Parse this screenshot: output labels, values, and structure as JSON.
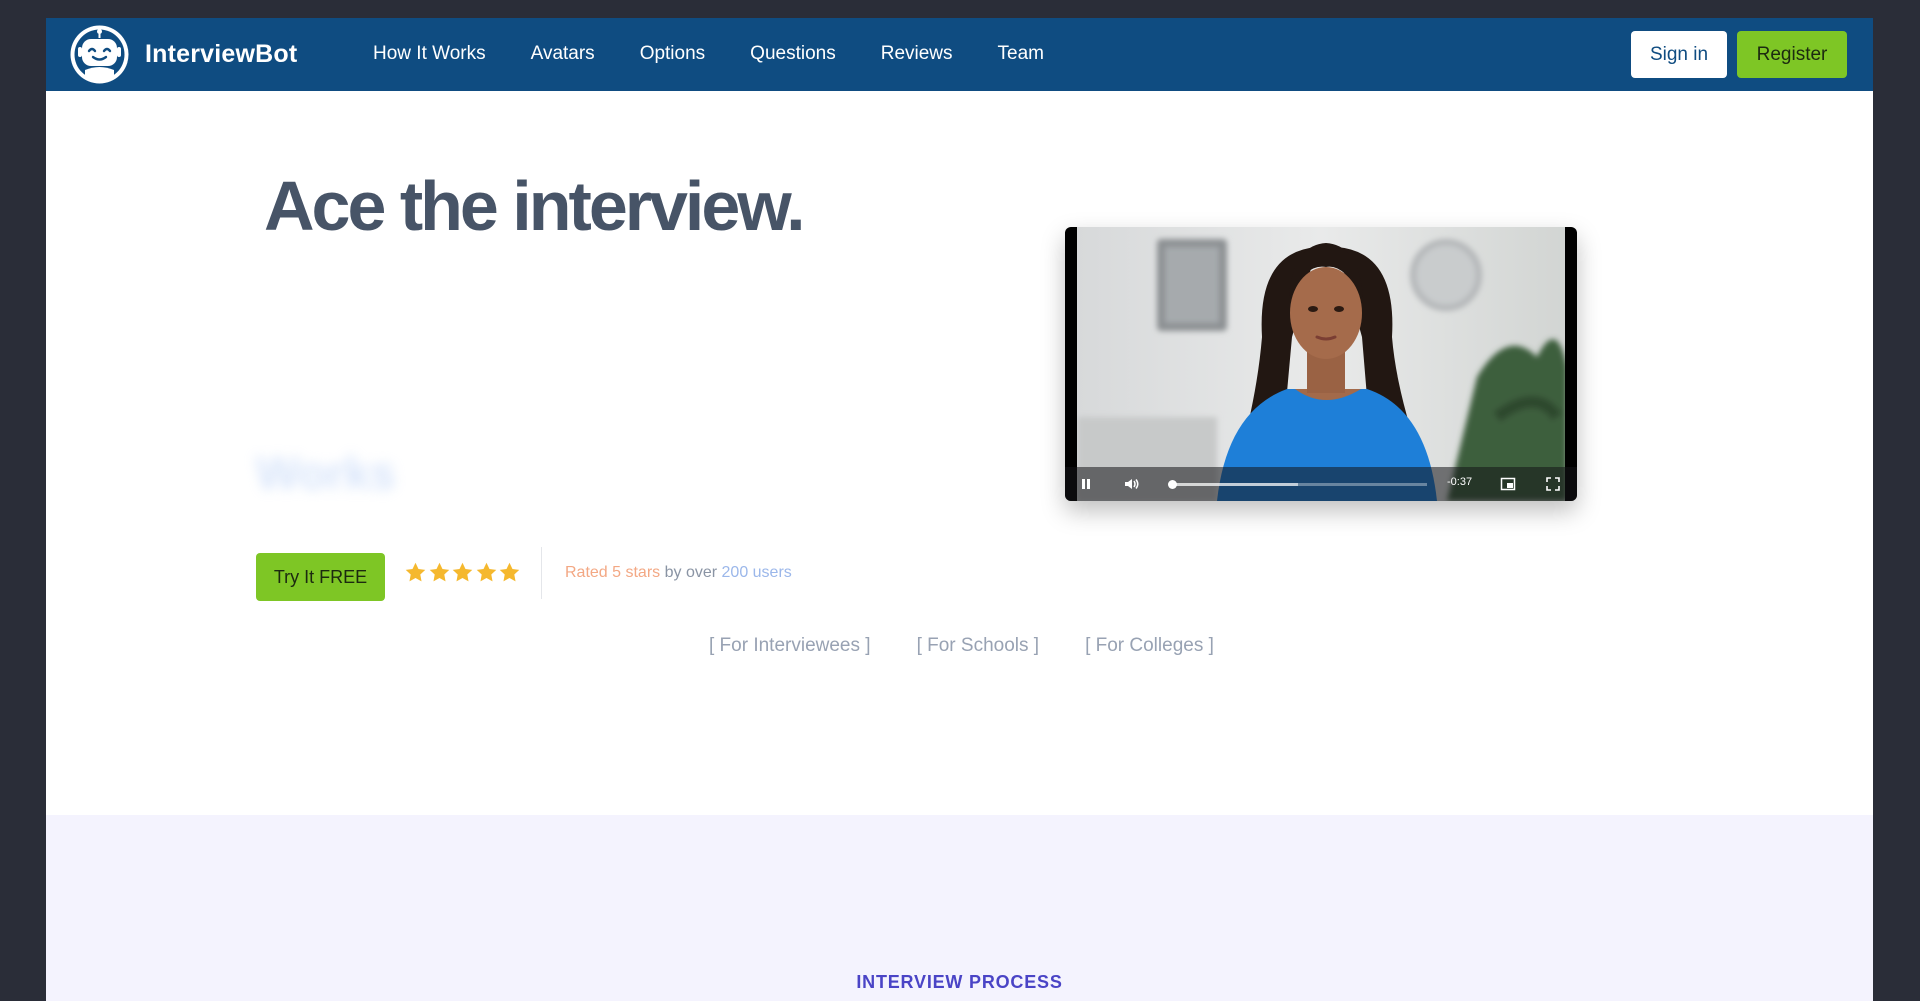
{
  "nav": {
    "brand": "InterviewBot",
    "links": [
      "How It Works",
      "Avatars",
      "Options",
      "Questions",
      "Reviews",
      "Team"
    ],
    "sign_in": "Sign in",
    "register": "Register",
    "background_color": "#0f4c81"
  },
  "hero": {
    "headline": "Ace the interview.",
    "blurred_word": "Works",
    "cta": "Try It FREE",
    "rating": {
      "stars": 5,
      "part1": "Rated ",
      "highlight1": "5 stars",
      "part2": " by over ",
      "highlight2": "200 users"
    },
    "audience_links": [
      "[ For Interviewees ]",
      "[ For Schools ]",
      "[ For Colleges ]"
    ]
  },
  "video": {
    "time_remaining": "-0:37",
    "progress": 0.01,
    "buffered": 0.5,
    "icons": [
      "pause-icon",
      "volume-icon",
      "picture-in-picture-icon",
      "fullscreen-icon"
    ]
  },
  "process": {
    "label": "INTERVIEW PROCESS"
  },
  "colors": {
    "accent_green": "#7ec625",
    "star": "#f5b82e",
    "process_label": "#4a44c6"
  }
}
